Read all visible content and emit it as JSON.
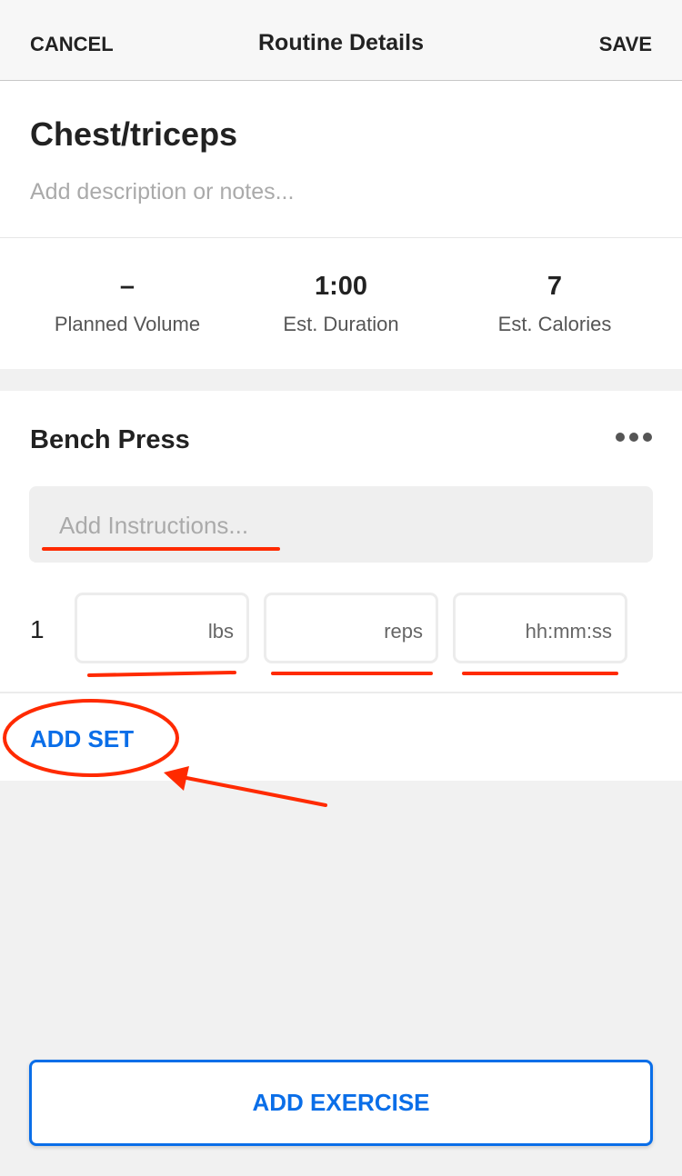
{
  "header": {
    "cancel": "CANCEL",
    "title": "Routine Details",
    "save": "SAVE"
  },
  "routine": {
    "name": "Chest/triceps",
    "description_placeholder": "Add description or notes..."
  },
  "stats": [
    {
      "value": "–",
      "label": "Planned Volume"
    },
    {
      "value": "1:00",
      "label": "Est. Duration"
    },
    {
      "value": "7",
      "label": "Est. Calories"
    }
  ],
  "exercise": {
    "name": "Bench Press",
    "instructions_placeholder": "Add Instructions...",
    "sets": [
      {
        "number": "1",
        "weight_placeholder": "lbs",
        "reps_placeholder": "reps",
        "time_placeholder": "hh:mm:ss"
      }
    ],
    "add_set": "ADD SET"
  },
  "add_exercise": "ADD EXERCISE",
  "colors": {
    "accent": "#0a6ee8",
    "annotation": "#ff2a00"
  }
}
